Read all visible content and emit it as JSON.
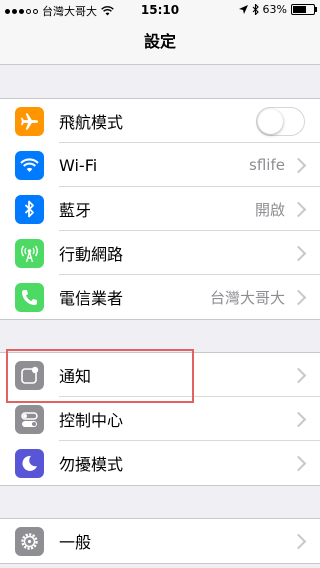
{
  "status_bar": {
    "carrier": "台灣大哥大",
    "time": "15:10",
    "battery": "63%",
    "battery_level": 0.63,
    "signal_bars": 3,
    "signal_total": 5
  },
  "nav": {
    "title": "設定"
  },
  "groups": [
    [
      {
        "label": "飛航模式",
        "accessory": "toggle",
        "toggle_on": false,
        "icon": "airplane-icon",
        "color": "#ff9500"
      },
      {
        "label": "Wi-Fi",
        "value": "sflife",
        "accessory": "chevron",
        "icon": "wifi-icon",
        "color": "#007aff"
      },
      {
        "label": "藍牙",
        "value": "開啟",
        "accessory": "chevron",
        "icon": "bluetooth-icon",
        "color": "#007aff"
      },
      {
        "label": "行動網路",
        "accessory": "chevron",
        "icon": "antenna-icon",
        "color": "#4cd964"
      },
      {
        "label": "電信業者",
        "value": "台灣大哥大",
        "accessory": "chevron",
        "icon": "phone-icon",
        "color": "#4cd964"
      }
    ],
    [
      {
        "label": "通知",
        "accessory": "chevron",
        "icon": "notifications-icon",
        "color": "#8e8e93"
      },
      {
        "label": "控制中心",
        "accessory": "chevron",
        "icon": "control-center-icon",
        "color": "#8e8e93"
      },
      {
        "label": "勿擾模式",
        "accessory": "chevron",
        "icon": "moon-icon",
        "color": "#5856d6"
      }
    ],
    [
      {
        "label": "一般",
        "accessory": "chevron",
        "icon": "gear-icon",
        "color": "#8e8e93"
      }
    ]
  ]
}
